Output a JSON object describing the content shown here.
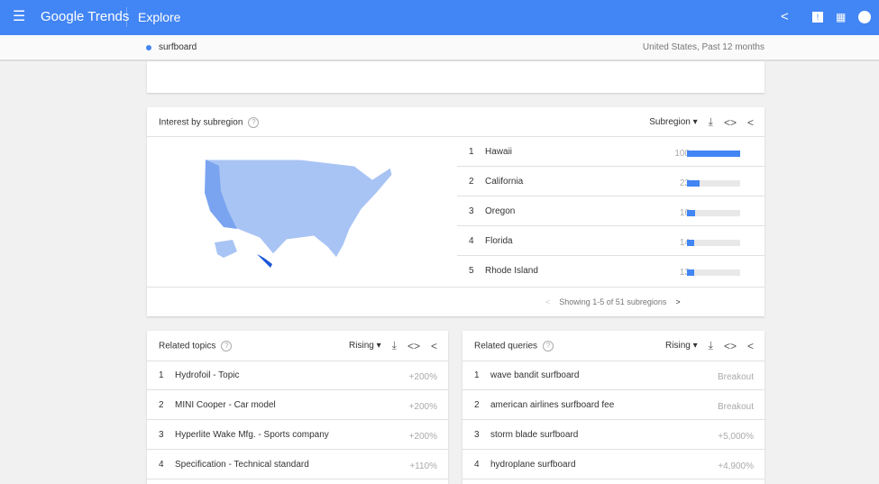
{
  "header": {
    "app_title": "Google Trends",
    "section": "Explore"
  },
  "subheader": {
    "term": "surfboard",
    "context": "United States, Past 12 months"
  },
  "colors": {
    "brand": "#4285f4",
    "bar": "#4285f4"
  },
  "subregion": {
    "title": "Interest by subregion",
    "dropdown": "Subregion",
    "rows": [
      {
        "rank": "1",
        "name": "Hawaii",
        "value": 100
      },
      {
        "rank": "2",
        "name": "California",
        "value": 23
      },
      {
        "rank": "3",
        "name": "Oregon",
        "value": 16
      },
      {
        "rank": "4",
        "name": "Florida",
        "value": 14
      },
      {
        "rank": "5",
        "name": "Rhode Island",
        "value": 13
      }
    ],
    "pagination": "Showing 1-5 of 51 subregions"
  },
  "related_topics": {
    "title": "Related topics",
    "dropdown": "Rising",
    "rows": [
      {
        "rank": "1",
        "name": "Hydrofoil - Topic",
        "value": "+200%"
      },
      {
        "rank": "2",
        "name": "MINI Cooper - Car model",
        "value": "+200%"
      },
      {
        "rank": "3",
        "name": "Hyperlite Wake Mfg. - Sports company",
        "value": "+200%"
      },
      {
        "rank": "4",
        "name": "Specification - Technical standard",
        "value": "+110%"
      }
    ]
  },
  "related_queries": {
    "title": "Related queries",
    "dropdown": "Rising",
    "rows": [
      {
        "rank": "1",
        "name": "wave bandit surfboard",
        "value": "Breakout"
      },
      {
        "rank": "2",
        "name": "american airlines surfboard fee",
        "value": "Breakout"
      },
      {
        "rank": "3",
        "name": "storm blade surfboard",
        "value": "+5,000%"
      },
      {
        "rank": "4",
        "name": "hydroplane surfboard",
        "value": "+4,900%"
      }
    ]
  }
}
